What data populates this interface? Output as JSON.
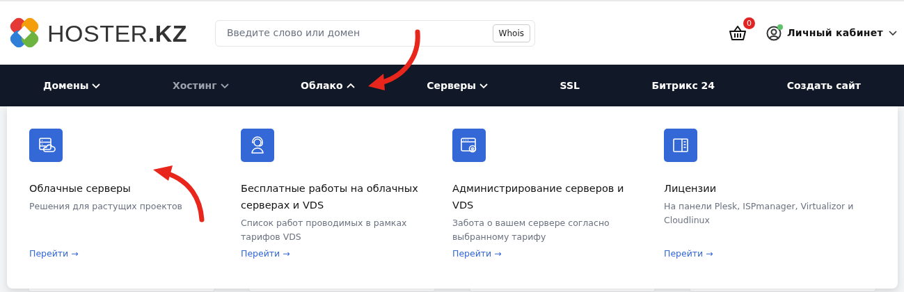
{
  "header": {
    "logo_text": "HOSTER",
    "logo_suffix": ".KZ",
    "search": {
      "placeholder": "Введите слово или домен",
      "button": "Whois"
    },
    "cart_count": "0",
    "account": {
      "label": "Личный кабинет",
      "online": true
    }
  },
  "nav": [
    {
      "kind": "dropdown",
      "label": "Домены",
      "expanded": false,
      "dimmed": false
    },
    {
      "kind": "dropdown",
      "label": "Хостинг",
      "expanded": false,
      "dimmed": true
    },
    {
      "kind": "dropdown",
      "label": "Облако",
      "expanded": true,
      "dimmed": false
    },
    {
      "kind": "dropdown",
      "label": "Серверы",
      "expanded": false,
      "dimmed": false
    },
    {
      "kind": "link",
      "label": "SSL",
      "dimmed": false
    },
    {
      "kind": "link",
      "label": "Битрикс 24",
      "dimmed": false
    },
    {
      "kind": "link",
      "label": "Создать сайт",
      "dimmed": false
    }
  ],
  "menu_items": [
    {
      "kind": "cloud",
      "title": "Облачные серверы",
      "description": "Решения для растущих проектов",
      "link": "Перейти →"
    },
    {
      "kind": "support",
      "title": "Бесплатные работы на облачных серверах и VDS",
      "description": "Список работ проводимых в рамках тарифов VDS",
      "link": "Перейти →"
    },
    {
      "kind": "admin",
      "title": "Администрирование серверов и VDS",
      "description": "Забота о вашем сервере согласно выбранному тарифу",
      "link": "Перейти →"
    },
    {
      "kind": "license",
      "title": "Лицензии",
      "description": "На панели Plesk, ISPmanager, Virtualizor и Cloudlinux",
      "link": "Перейти →"
    }
  ]
}
